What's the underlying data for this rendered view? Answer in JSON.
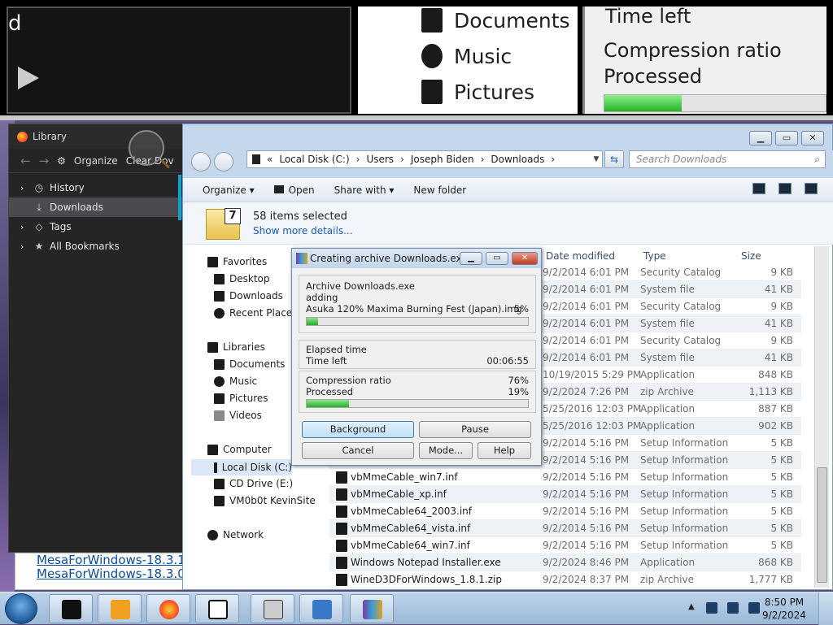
{
  "zoom_strip": {
    "left_letter": "d",
    "items": [
      "Documents",
      "Music",
      "Pictures"
    ],
    "time_left": "Time left",
    "compression_ratio": "Compression ratio",
    "processed": "Processed",
    "progress_fraction": 0.35
  },
  "library": {
    "title": "Library",
    "organize": "Organize",
    "clear": "Clear Dov",
    "tree": [
      {
        "label": "History",
        "icon": "clock-icon",
        "chevron": true,
        "selected": false
      },
      {
        "label": "Downloads",
        "icon": "download-icon",
        "chevron": false,
        "selected": true
      },
      {
        "label": "Tags",
        "icon": "tag-icon",
        "chevron": true,
        "selected": false
      },
      {
        "label": "All Bookmarks",
        "icon": "star-icon",
        "chevron": true,
        "selected": false
      }
    ],
    "bottom_links": [
      "MesaForWindows-18.3.1",
      "MesaForWindows-18.3.0"
    ]
  },
  "explorer": {
    "breadcrumb": [
      "Local Disk (C:)",
      "Users",
      "Joseph Biden",
      "Downloads"
    ],
    "search_placeholder": "Search Downloads",
    "commands": {
      "organize": "Organize",
      "open": "Open",
      "share": "Share with",
      "new_folder": "New folder"
    },
    "details": {
      "selected": "58 items selected",
      "more": "Show more details..."
    },
    "nav": {
      "favorites": "Favorites",
      "fav_items": [
        "Desktop",
        "Downloads",
        "Recent Places"
      ],
      "libraries": "Libraries",
      "lib_items": [
        "Documents",
        "Music",
        "Pictures",
        "Videos"
      ],
      "computer": "Computer",
      "comp_items": [
        "Local Disk (C:)",
        "CD Drive (E:)",
        "VM0b0t KevinSite"
      ],
      "network": "Network"
    },
    "columns": {
      "date": "Date modified",
      "type": "Type",
      "size": "Size"
    },
    "rows": [
      {
        "name": "",
        "date": "9/2/2014 6:01 PM",
        "type": "Security Catalog",
        "size": "9 KB"
      },
      {
        "name": "",
        "date": "9/2/2014 6:01 PM",
        "type": "System file",
        "size": "41 KB"
      },
      {
        "name": "",
        "date": "9/2/2014 6:01 PM",
        "type": "Security Catalog",
        "size": "9 KB"
      },
      {
        "name": "",
        "date": "9/2/2014 6:01 PM",
        "type": "System file",
        "size": "41 KB"
      },
      {
        "name": "",
        "date": "9/2/2014 6:01 PM",
        "type": "Security Catalog",
        "size": "9 KB"
      },
      {
        "name": "",
        "date": "9/2/2014 6:01 PM",
        "type": "System file",
        "size": "41 KB"
      },
      {
        "name": "",
        "date": "10/19/2015 5:29 PM",
        "type": "Application",
        "size": "848 KB"
      },
      {
        "name": "",
        "date": "9/2/2024 7:26 PM",
        "type": "zip Archive",
        "size": "1,113 KB"
      },
      {
        "name": "",
        "date": "5/25/2016 12:03 PM",
        "type": "Application",
        "size": "887 KB"
      },
      {
        "name": "",
        "date": "5/25/2016 12:03 PM",
        "type": "Application",
        "size": "902 KB"
      },
      {
        "name": "",
        "date": "9/2/2014 5:16 PM",
        "type": "Setup Information",
        "size": "5 KB"
      },
      {
        "name": "",
        "date": "9/2/2014 5:16 PM",
        "type": "Setup Information",
        "size": "5 KB"
      },
      {
        "name": "vbMmeCable_win7.inf",
        "date": "9/2/2014 5:16 PM",
        "type": "Setup Information",
        "size": "5 KB"
      },
      {
        "name": "vbMmeCable_xp.inf",
        "date": "9/2/2014 5:16 PM",
        "type": "Setup Information",
        "size": "5 KB"
      },
      {
        "name": "vbMmeCable64_2003.inf",
        "date": "9/2/2014 5:16 PM",
        "type": "Setup Information",
        "size": "5 KB"
      },
      {
        "name": "vbMmeCable64_vista.inf",
        "date": "9/2/2014 5:16 PM",
        "type": "Setup Information",
        "size": "5 KB"
      },
      {
        "name": "vbMmeCable64_win7.inf",
        "date": "9/2/2014 5:16 PM",
        "type": "Setup Information",
        "size": "5 KB"
      },
      {
        "name": "Windows Notepad Installer.exe",
        "date": "9/2/2024 8:46 PM",
        "type": "Application",
        "size": "868 KB"
      },
      {
        "name": "WineD3DForWindows_1.8.1.zip",
        "date": "9/2/2024 8:37 PM",
        "type": "zip Archive",
        "size": "1,777 KB"
      }
    ]
  },
  "rar": {
    "title": "Creating archive Downloads.exe",
    "archive": "Archive Downloads.exe",
    "action": "adding",
    "file": "Asuka 120% Maxima Burning Fest (Japan).img",
    "file_pct": "5%",
    "file_progress": 0.05,
    "elapsed": "Elapsed time",
    "time_left": "Time left",
    "time_left_value": "00:06:55",
    "ratio": "Compression ratio",
    "ratio_value": "76%",
    "processed": "Processed",
    "processed_value": "19%",
    "processed_progress": 0.19,
    "buttons": {
      "background": "Background",
      "pause": "Pause",
      "cancel": "Cancel",
      "mode": "Mode...",
      "help": "Help"
    }
  },
  "taskbar": {
    "time": "8:50 PM",
    "date": "9/2/2024"
  }
}
